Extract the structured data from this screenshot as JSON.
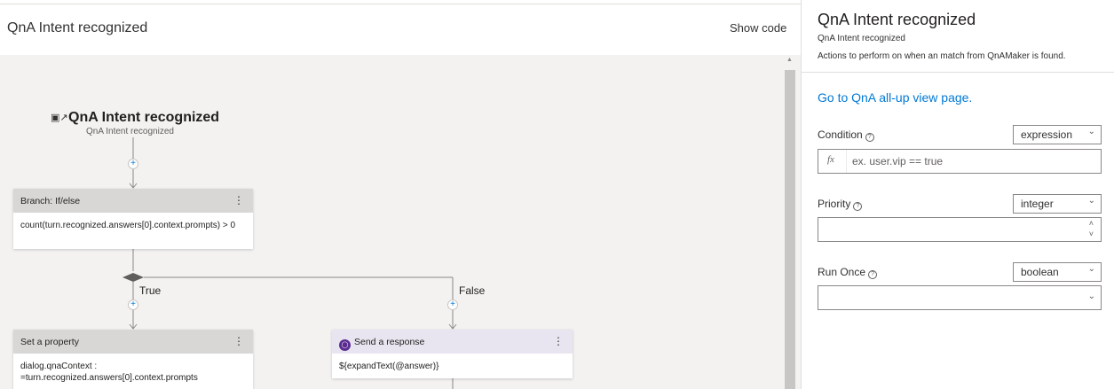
{
  "header": {
    "title": "QnA Intent recognized",
    "show_code": "Show code"
  },
  "flow": {
    "trigger": {
      "title": "QnA Intent recognized",
      "subtitle": "QnA Intent recognized"
    },
    "branch": {
      "title": "Branch: If/else",
      "condition": "count(turn.recognized.answers[0].context.prompts) > 0",
      "true_label": "True",
      "false_label": "False"
    },
    "set_property": {
      "title": "Set a property",
      "body": "dialog.qnaContext : =turn.recognized.answers[0].context.prompts"
    },
    "send_response": {
      "title": "Send a response",
      "body": "${expandText(@answer)}"
    }
  },
  "panel": {
    "title": "QnA Intent recognized",
    "subtitle": "QnA Intent recognized",
    "description": "Actions to perform on when an match from QnAMaker is found.",
    "link": "Go to QnA all-up view page.",
    "condition": {
      "label": "Condition",
      "type": "expression",
      "fx": "fx",
      "placeholder": "ex. user.vip == true"
    },
    "priority": {
      "label": "Priority",
      "type": "integer",
      "value": ""
    },
    "run_once": {
      "label": "Run Once",
      "type": "boolean",
      "value": ""
    }
  },
  "icons": [
    "trigger-icon",
    "more-icon",
    "plus-icon",
    "chevron-down-icon",
    "help-icon",
    "response-icon",
    "spin-up-icon",
    "spin-down-icon"
  ],
  "colors": {
    "accent": "#0078d4",
    "canvas": "#f3f2f1",
    "node_header": "#d8d7d6",
    "response_header": "#e9e5f0",
    "response_icon": "#5c2d91"
  }
}
